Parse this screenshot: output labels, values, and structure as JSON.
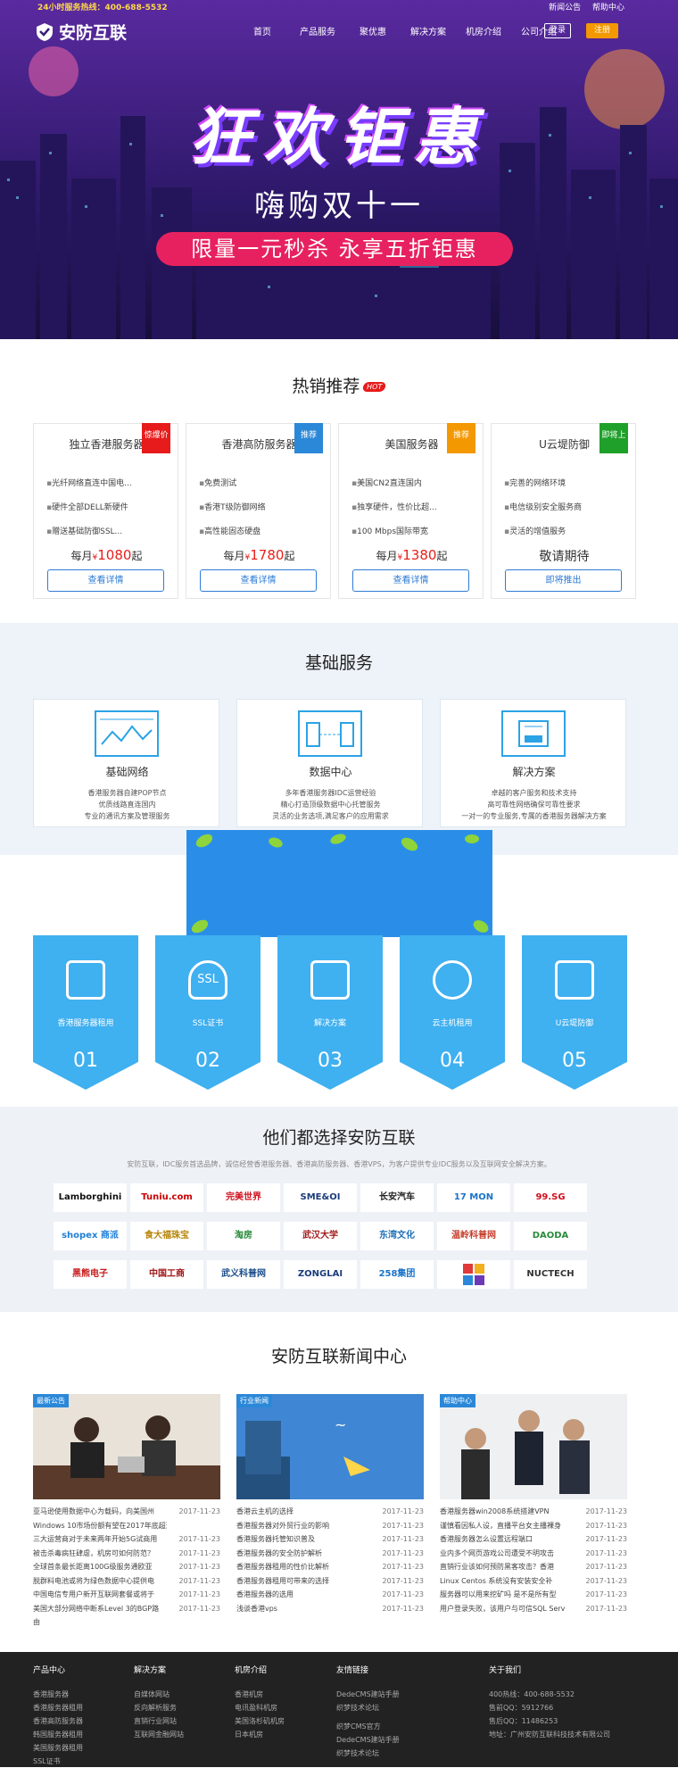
{
  "topbar": {
    "hotline": "24小时服务热线：400-688-5532",
    "links": [
      "新闻公告",
      "帮助中心"
    ]
  },
  "nav": {
    "logo": "安防互联",
    "items": [
      "首页",
      "产品服务",
      "聚优惠",
      "解决方案",
      "机房介绍",
      "公司介绍"
    ],
    "login": "登录",
    "register": "注册"
  },
  "banner": {
    "title": "狂欢钜惠",
    "subtitle": "嗨购双十一",
    "pill": "限量一元秒杀  永享五折钜惠"
  },
  "hot": {
    "title": "热销推荐",
    "badge": "HOT",
    "cards": [
      {
        "title": "独立香港服务器",
        "ribbon": "惊爆价",
        "ribbon_color": "#e71b1b",
        "features": [
          "光纤网络直连中国电...",
          "硬件全部DELL新硬件",
          "赠送基础防御SSL..."
        ],
        "price_prefix": "每月",
        "currency": "¥",
        "price": "1080",
        "price_suffix": "起",
        "button": "查看详情"
      },
      {
        "title": "香港高防服务器",
        "ribbon": "推荐",
        "ribbon_color": "#2b88d8",
        "features": [
          "免费测试",
          "香港T级防御网络",
          "高性能固态硬盘"
        ],
        "price_prefix": "每月",
        "currency": "¥",
        "price": "1780",
        "price_suffix": "起",
        "button": "查看详情"
      },
      {
        "title": "美国服务器",
        "ribbon": "推荐",
        "ribbon_color": "#f39800",
        "features": [
          "美国CN2直连国内",
          "独享硬件，性价比超...",
          "100 Mbps国际带宽"
        ],
        "price_prefix": "每月",
        "currency": "¥",
        "price": "1380",
        "price_suffix": "起",
        "button": "查看详情"
      },
      {
        "title": "U云堤防御",
        "ribbon": "即将上",
        "ribbon_color": "#1fa02a",
        "features": [
          "完善的网络环境",
          "电信级别安全服务商",
          "灵活的增值服务"
        ],
        "price_text": "敬请期待",
        "button": "即将推出"
      }
    ]
  },
  "basic": {
    "title": "基础服务",
    "cards": [
      {
        "title": "基础网络",
        "desc": [
          "香港服务器自建POP节点",
          "优质线路直连国内",
          "专业的通讯方案及管理服务"
        ]
      },
      {
        "title": "数据中心",
        "desc": [
          "多年香港服务器IDC运营经验",
          "精心打造顶级数据中心托管服务",
          "灵活的业务选项,满足客户的应用需求"
        ]
      },
      {
        "title": "解决方案",
        "desc": [
          "卓越的客户服务和技术支持",
          "高可靠性网络确保可靠性要求",
          "一对一的专业服务,专属的香港服务器解决方案"
        ]
      }
    ]
  },
  "services": [
    {
      "label": "香港服务器租用",
      "num": "01"
    },
    {
      "label": "SSL证书",
      "num": "02",
      "icon_text": "SSL"
    },
    {
      "label": "解决方案",
      "num": "03"
    },
    {
      "label": "云主机租用",
      "num": "04"
    },
    {
      "label": "U云堤防御",
      "num": "05"
    }
  ],
  "partners": {
    "title": "他们都选择安防互联",
    "desc": "安防互联，IDC服务首选品牌，诚信经营香港服务器、香港高防服务器、香港VPS，为客户提供专业IDC服务以及互联网安全解决方案。",
    "logos": [
      "Lamborghini",
      "Tuniu.com",
      "完美世界",
      "SME&OI",
      "长安汽车",
      "17 MON",
      "99.SG",
      "shopex 商派",
      "食大福珠宝",
      "淘房",
      "武汉大学",
      "东湾文化",
      "温岭科普网",
      "DAODA",
      "黑熊电子",
      "中国工商",
      "武义科普网",
      "ZONGLAI",
      "258集团",
      "",
      "NUCTECH"
    ]
  },
  "news": {
    "title": "安防互联新闻中心",
    "columns": [
      {
        "tag": "最新公告",
        "items": [
          [
            "亚马逊使用数据中心为载码，向美国州",
            "2017-11-23"
          ],
          [
            "Windows 10市场份额有望在2017年底超过",
            ""
          ],
          [
            "三大运营商对于未来两年开始5G试商用",
            "2017-11-23"
          ],
          [
            "被击杀毒病狂肆虐，机房可如何防范？",
            "2017-11-23"
          ],
          [
            "全球首条最长距离100G级服务通欧亚",
            "2017-11-23"
          ],
          [
            "脱群料电池或将为绿色数据中心提供电",
            "2017-11-23"
          ],
          [
            "中国电信专用户新开互联网套餐或将于",
            "2017-11-23"
          ],
          [
            "美国大部分网络中断系Level 3的BGP路",
            "2017-11-23"
          ],
          [
            "由",
            ""
          ]
        ]
      },
      {
        "tag": "行业新闻",
        "items": [
          [
            "香港云主机的选择",
            "2017-11-23"
          ],
          [
            "香港服务器对外贸行业的影响",
            "2017-11-23"
          ],
          [
            "香港服务器托管知识普及",
            "2017-11-23"
          ],
          [
            "香港服务器的安全防护解析",
            "2017-11-23"
          ],
          [
            "香港服务器租用的性价比解析",
            "2017-11-23"
          ],
          [
            "香港服务器租用可带来的选择",
            "2017-11-23"
          ],
          [
            "香港服务器的选用",
            "2017-11-23"
          ],
          [
            "浅谈香港vps",
            "2017-11-23"
          ]
        ]
      },
      {
        "tag": "帮助中心",
        "items": [
          [
            "香港服务器win2008系统搭建VPN",
            "2017-11-23"
          ],
          [
            "谨慎看因私人设，直播平台女主播裸身",
            "2017-11-23"
          ],
          [
            "香港服务器怎么设置远程端口",
            "2017-11-23"
          ],
          [
            "业内多个网页游戏公司遭受不明攻击",
            "2017-11-23"
          ],
          [
            "直销行业该如何预防黑客攻击？香港",
            "2017-11-23"
          ],
          [
            "Linux Centos 系统没有安装安全补",
            "2017-11-23"
          ],
          [
            "服务器可以用来挖矿吗 是不是所有型",
            "2017-11-23"
          ],
          [
            "用户登录失败，该用户与可信SQL Serv",
            "2017-11-23"
          ]
        ]
      }
    ]
  },
  "footer": {
    "cols": [
      {
        "title": "产品中心",
        "items": [
          "香港服务器",
          "香港服务器租用",
          "香港高防服务器",
          "韩国服务器租用",
          "美国服务器租用",
          "SSL证书"
        ]
      },
      {
        "title": "解决方案",
        "items": [
          "自媒体网站",
          "反向解析服务",
          "直销行业网站",
          "互联网金融网站"
        ]
      },
      {
        "title": "机房介绍",
        "items": [
          "香港机房",
          "电讯盈科机房",
          "美国洛杉矶机房",
          "日本机房"
        ]
      },
      {
        "title": "友情链接",
        "items": [
          "DedeCMS建站手册",
          "织梦技术论坛",
          "",
          "织梦CMS官方",
          "DedeCMS建站手册",
          "织梦技术论坛"
        ]
      },
      {
        "title": "关于我们",
        "items": [
          "400热线：400-688-5532",
          "售前QQ：5912766",
          "售后QQ：11486253",
          "地址：广州安防互联科技技术有限公司"
        ]
      }
    ]
  },
  "colors": {
    "accent": "#2b88d8",
    "orange": "#f39800",
    "price": "#e7211a",
    "service_blue": "#3fb0f0"
  }
}
